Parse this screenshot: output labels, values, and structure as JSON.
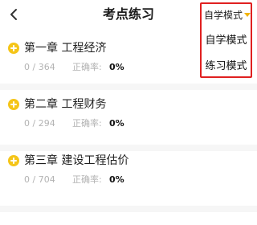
{
  "header": {
    "title": "考点练习",
    "mode_selected": "自学模式",
    "back_icon": "chevron-left-icon"
  },
  "mode_menu": {
    "options": [
      "自学模式",
      "练习模式"
    ]
  },
  "chapters": [
    {
      "title": "第一章 工程经济",
      "progress": "0 / 364",
      "accuracy_label": "正确率:",
      "accuracy": "0%"
    },
    {
      "title": "第二章 工程财务",
      "progress": "0 / 294",
      "accuracy_label": "正确率:",
      "accuracy": "0%"
    },
    {
      "title": "第三章 建设工程估价",
      "progress": "0 / 704",
      "accuracy_label": "正确率:",
      "accuracy": "0%"
    }
  ],
  "colors": {
    "accent_yellow": "#f5c518",
    "highlight_red": "#e02020",
    "muted_text": "#b3b3b3"
  }
}
